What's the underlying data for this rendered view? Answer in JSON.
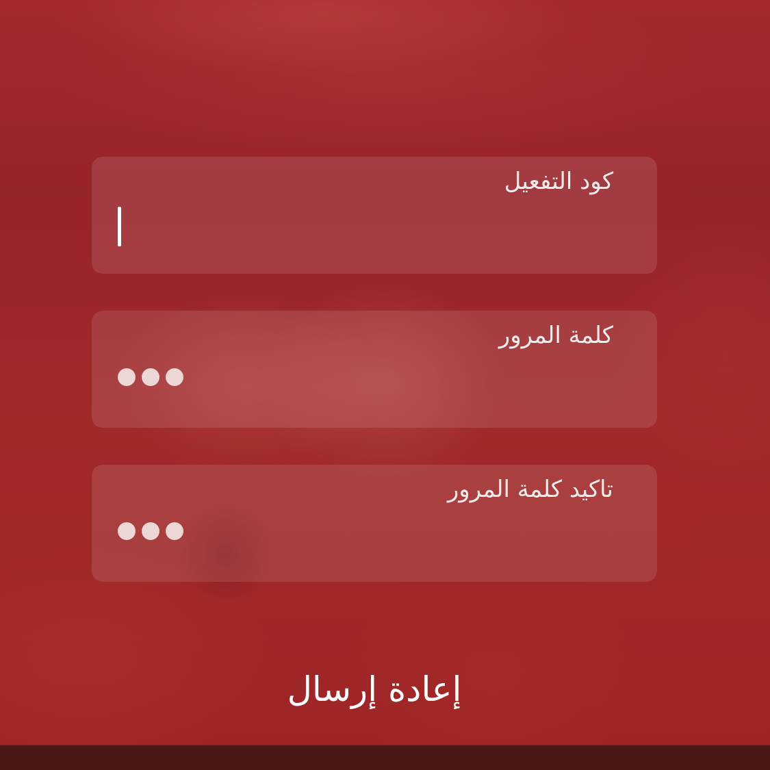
{
  "form": {
    "activation_code": {
      "label": "كود التفعيل",
      "value": ""
    },
    "password": {
      "label": "كلمة المرور",
      "masked_length": 3
    },
    "confirm_password": {
      "label": "تاكيد كلمة المرور",
      "masked_length": 3
    }
  },
  "actions": {
    "resend_label": "إعادة إرسال"
  },
  "colors": {
    "background": "#9c2426",
    "field_fill": "rgba(255,255,255,0.11)",
    "bottom_bar": "#4b1817",
    "text": "#ffffff"
  }
}
